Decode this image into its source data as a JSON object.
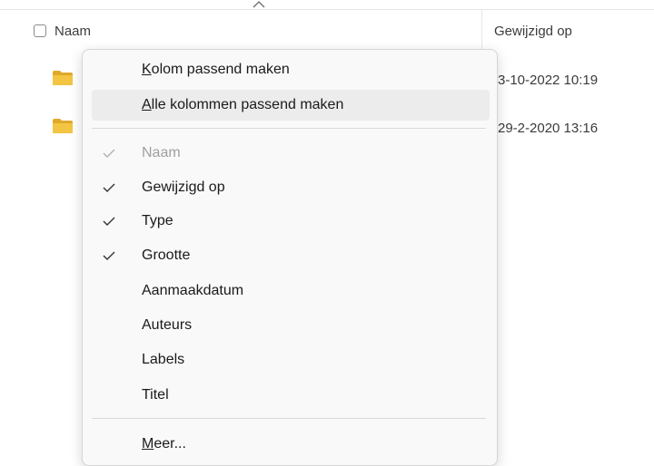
{
  "header": {
    "name_label": "Naam",
    "modified_label": "Gewijzigd op"
  },
  "rows": [
    {
      "date": "3-10-2022 10:19",
      "icon": "folder-icon"
    },
    {
      "date": "29-2-2020 13:16",
      "icon": "folder-icon"
    }
  ],
  "context_menu": {
    "fit_column": {
      "underline": "K",
      "rest": "olom passend maken"
    },
    "fit_all_columns": {
      "underline": "A",
      "rest": "lle kolommen passend maken"
    },
    "columns": [
      {
        "label": "Naam",
        "checked": true,
        "disabled": true
      },
      {
        "label": "Gewijzigd op",
        "checked": true,
        "disabled": false
      },
      {
        "label": "Type",
        "checked": true,
        "disabled": false
      },
      {
        "label": "Grootte",
        "checked": true,
        "disabled": false
      },
      {
        "label": "Aanmaakdatum",
        "checked": false,
        "disabled": false
      },
      {
        "label": "Auteurs",
        "checked": false,
        "disabled": false
      },
      {
        "label": "Labels",
        "checked": false,
        "disabled": false
      },
      {
        "label": "Titel",
        "checked": false,
        "disabled": false
      }
    ],
    "more": {
      "underline": "M",
      "rest": "eer..."
    }
  },
  "colors": {
    "folder": "#f4c443",
    "folder_dark": "#e0a92a",
    "highlight": "#ececec",
    "disabled_text": "#a0a0a0"
  }
}
